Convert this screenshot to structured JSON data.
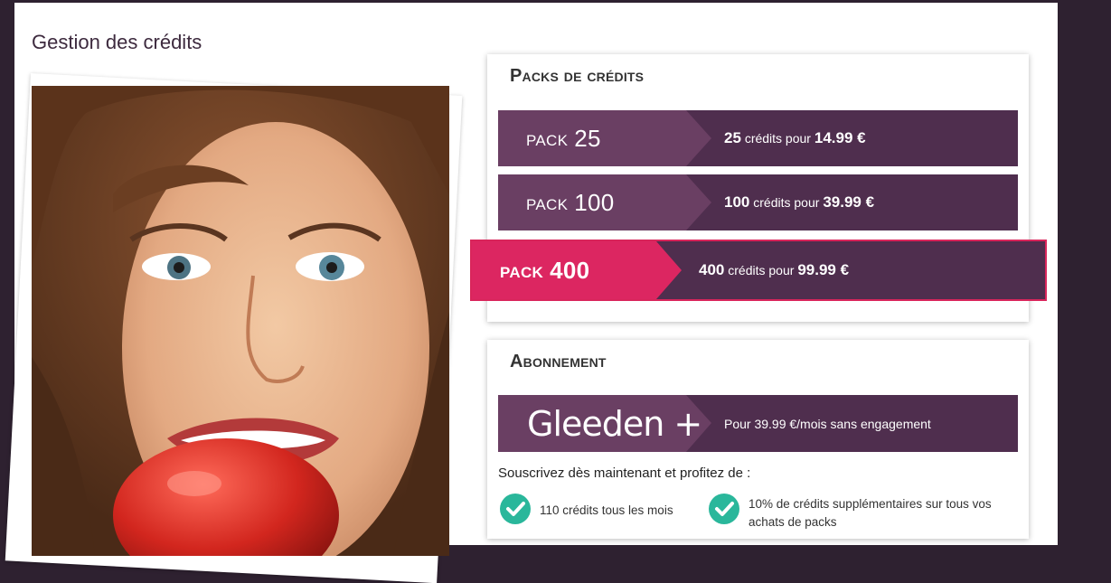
{
  "page": {
    "title": "Gestion des crédits"
  },
  "packs": {
    "title": "Packs de crédits",
    "items": [
      {
        "label": "PACK",
        "number": "25",
        "credits": "25",
        "middle": "crédits pour",
        "price": "14.99 €"
      },
      {
        "label": "PACK",
        "number": "100",
        "credits": "100",
        "middle": "crédits pour",
        "price": "39.99 €"
      },
      {
        "label": "PACK",
        "number": "400",
        "credits": "400",
        "middle": "crédits pour",
        "price": "99.99 €"
      }
    ]
  },
  "subscription": {
    "title": "Abonnement",
    "logo_text": "Gleeden +",
    "offer": "Pour 39.99 €/mois sans engagement",
    "intro": "Souscrivez dès maintenant et profitez de :",
    "benefits": [
      "110 crédits tous les mois",
      "10% de crédits supplémentaires sur tous vos achats de packs"
    ]
  },
  "colors": {
    "background": "#2e2130",
    "pack_dark": "#4f2e4e",
    "pack_light": "#6a3f63",
    "highlight": "#dc2661",
    "check": "#2ab79b"
  },
  "icons": {
    "check": "check-circle-icon"
  }
}
